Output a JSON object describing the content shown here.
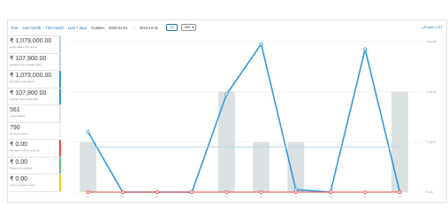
{
  "toolbar": {
    "year": "Year",
    "last_month": "Last month",
    "this_month": "This month",
    "last_7_days": "Last 7 days",
    "custom_label": "Custom:",
    "date_from": "2024-01-01",
    "date_sep": "–",
    "date_to": "2024-10-31",
    "go_label": "Go",
    "currency": "INR",
    "export": "Export CSV"
  },
  "legend": [
    {
      "value": "₹ 1,079,000.00",
      "label": "gross sales in this period",
      "color": "#b1d4ea"
    },
    {
      "value": "₹ 107,900.00",
      "label": "average gross monthly sales",
      "color": "#b1d4ea"
    },
    {
      "value": "₹ 1,079,000.00",
      "label": "net sales in this period",
      "color": "#3498db"
    },
    {
      "value": "₹ 107,900.00",
      "label": "average net monthly sales",
      "color": "#3498db"
    },
    {
      "value": "561",
      "label": "orders placed",
      "color": "#dbe1e3"
    },
    {
      "value": "790",
      "label": "items purchased",
      "color": "#ecf0f1"
    },
    {
      "value": "₹ 0.00",
      "label": "refunded 0 orders (0 items)",
      "color": "#e74c3c"
    },
    {
      "value": "₹ 0.00",
      "label": "charged for shipping",
      "color": "#5cc488"
    },
    {
      "value": "₹ 0.00",
      "label": "worth of coupons used",
      "color": "#f1c40f"
    }
  ],
  "chart_data": {
    "type": "bar",
    "x": [
      "Jan",
      "Feb",
      "Mar",
      "Apr",
      "May",
      "Jun",
      "Jul",
      "Aug",
      "Sep",
      "Oct"
    ],
    "y_ticks": [
      "₹ 0.00",
      "₹ 100000",
      "₹ 200000",
      "₹ 300000"
    ],
    "series": [
      {
        "kind": "bar",
        "values": [
          100000,
          0,
          0,
          0,
          200000,
          100000,
          100000,
          0,
          0,
          200000
        ],
        "color": "#dbe1e3"
      },
      {
        "kind": "line",
        "values": [
          120000,
          0,
          0,
          0,
          195000,
          295000,
          5000,
          0,
          285000,
          0
        ],
        "color": "#3498db"
      },
      {
        "kind": "line",
        "values": [
          0,
          0,
          0,
          0,
          0,
          0,
          0,
          0,
          0,
          0
        ],
        "color": "#e74c3c"
      },
      {
        "kind": "line",
        "values": [
          90000,
          90000,
          90000,
          90000,
          90000,
          90000,
          90000,
          90000,
          90000,
          90000
        ],
        "color": "#b1d4ea"
      }
    ],
    "ylim": [
      0,
      300000
    ],
    "grid": "horizontal"
  },
  "colors": {
    "accent": "#2271b1",
    "net": "#3498db",
    "orders": "#dbe1e3",
    "refund": "#e74c3c"
  }
}
